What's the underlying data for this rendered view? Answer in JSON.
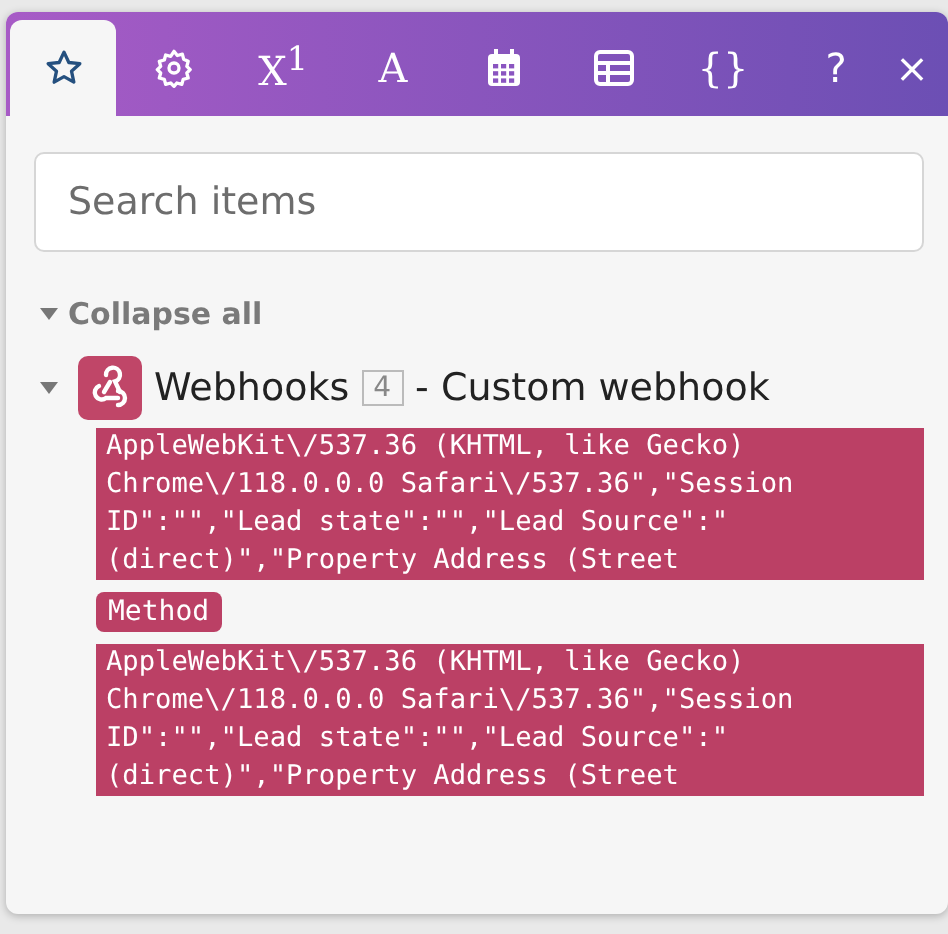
{
  "tabs": [
    {
      "kind": "star",
      "selected": true
    },
    {
      "kind": "gear",
      "selected": false
    },
    {
      "kind": "text",
      "label": "X$^{1}$",
      "selected": false
    },
    {
      "kind": "text",
      "label": "A",
      "selected": false
    },
    {
      "kind": "calendar",
      "selected": false
    },
    {
      "kind": "table",
      "selected": false
    },
    {
      "kind": "text",
      "label": "{}",
      "selected": false
    }
  ],
  "actions": [
    "?",
    "×"
  ],
  "search": {
    "placeholder": "Search items"
  },
  "collapse": {
    "label": "Collapse all",
    "expanded": true
  },
  "module": {
    "name": "Webhooks",
    "count": "4",
    "title": "- Custom webhook",
    "expanded": true
  },
  "items": [
    {
      "kind": "value",
      "lines": [
        "AppleWebKit\\/537.36 (KHTML, like Gecko)",
        "Chrome\\/118.0.0.0 Safari\\/537.36\",\"Session",
        "ID\":\"\",\"Lead state\":\"\",\"Lead Source\":\"",
        "(direct)\",\"Property Address (Street"
      ]
    },
    {
      "kind": "key",
      "label": "Method"
    },
    {
      "kind": "value",
      "lines": [
        "AppleWebKit\\/537.36 (KHTML, like Gecko)",
        "Chrome\\/118.0.0.0 Safari\\/537.36\",\"Session",
        "ID\":\"\",\"Lead state\":\"\",\"Lead Source\":\"",
        "(direct)\",\"Property Address (Street"
      ]
    }
  ]
}
